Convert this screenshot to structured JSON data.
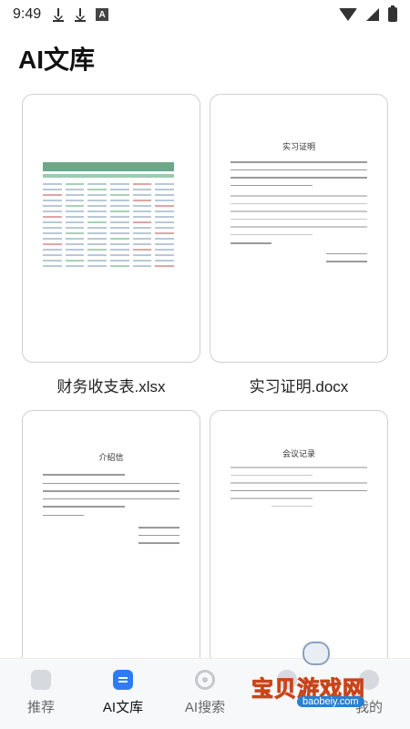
{
  "status": {
    "time": "9:49",
    "notification_badge": "A"
  },
  "page": {
    "title": "AI文库"
  },
  "docs": [
    {
      "name": "财务收支表.xlsx"
    },
    {
      "name": "实习证明.docx",
      "heading": "实习证明"
    },
    {
      "name": "",
      "heading": "介绍信"
    },
    {
      "name": "",
      "heading": "会议记录"
    }
  ],
  "nav": {
    "items": [
      {
        "label": "推荐",
        "icon": "recommend-icon"
      },
      {
        "label": "AI文库",
        "icon": "library-icon",
        "active": true
      },
      {
        "label": "AI搜索",
        "icon": "search-icon"
      },
      {
        "label": "",
        "icon": "message-icon"
      },
      {
        "label": "我的",
        "icon": "profile-icon"
      }
    ]
  },
  "watermark": {
    "text": "宝贝游戏网",
    "url": "baobeiy.com"
  },
  "colors": {
    "accent": "#2f7bf6",
    "sheet_header": "#6ea88a"
  }
}
